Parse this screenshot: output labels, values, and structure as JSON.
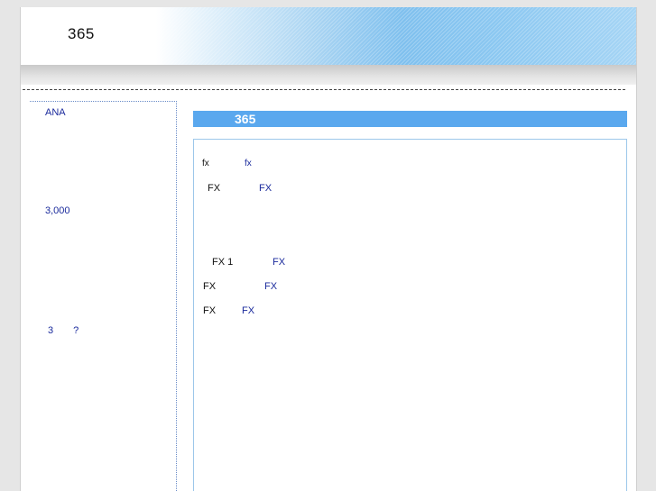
{
  "header": {
    "site_title": "365"
  },
  "sidebar": {
    "links": [
      {
        "label": "ANA"
      },
      {
        "label": "3,000"
      },
      {
        "label": "3　　?"
      }
    ]
  },
  "main": {
    "title": "365",
    "rows": [
      {
        "text": "fx",
        "link": "fx"
      },
      {
        "text": "FX",
        "link": "FX"
      },
      {
        "text": "FX 1",
        "link": "FX"
      },
      {
        "text": "FX",
        "link": "FX"
      },
      {
        "text": "FX",
        "link": "FX"
      }
    ]
  }
}
